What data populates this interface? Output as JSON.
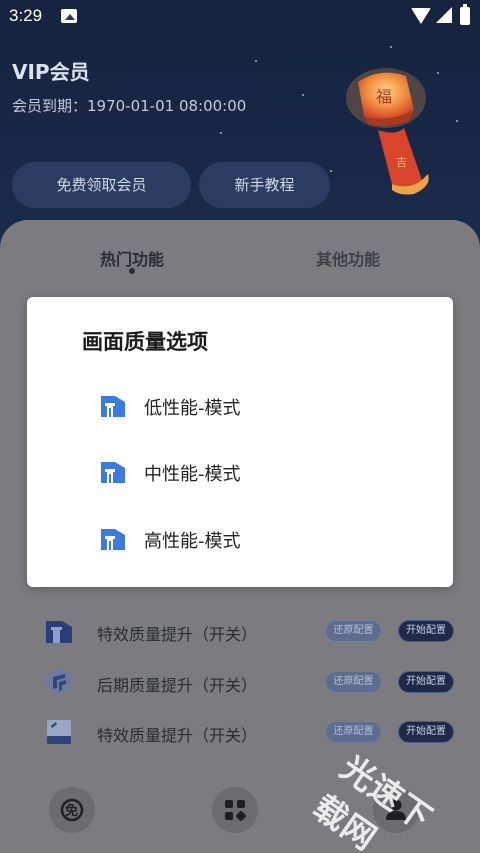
{
  "status_bar": {
    "time": "3:29"
  },
  "header": {
    "title": "VIP会员",
    "expire": "会员到期：1970-01-01 08:00:00",
    "free_vip_label": "免费领取会员",
    "tutorial_label": "新手教程"
  },
  "tabs": {
    "hot": "热门功能",
    "other": "其他功能"
  },
  "rows": [
    {
      "label": "特效质量提升（开关）",
      "restore": "还原配置",
      "start": "开始配置",
      "icon": "building-icon"
    },
    {
      "label": "后期质量提升（开关）",
      "restore": "还原配置",
      "start": "开始配置",
      "icon": "layers-icon"
    },
    {
      "label": "特效质量提升（开关）",
      "restore": "还原配置",
      "start": "开始配置",
      "icon": "card-icon"
    }
  ],
  "bottom_nav": [
    "free-icon",
    "grid-icon",
    "user-icon"
  ],
  "dialog": {
    "title": "画面质量选项",
    "options": [
      {
        "label": "低性能-模式"
      },
      {
        "label": "中性能-模式"
      },
      {
        "label": "高性能-模式"
      }
    ],
    "icon_color": "#3b7bdf"
  },
  "watermark": "光速下载网"
}
